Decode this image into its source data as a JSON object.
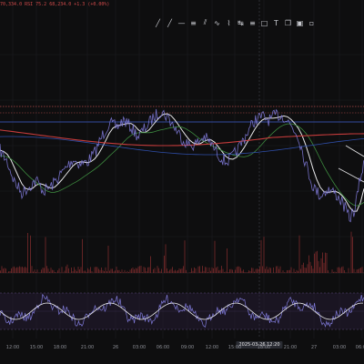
{
  "legend": {
    "items": [
      {
        "text": "70,334.0",
        "color": "#d04a4a"
      },
      {
        "text": "RSI 75.2",
        "color": "#d04a4a"
      },
      {
        "text": "68,234.0  +1.3 (+0.00%)",
        "color": "#d04a4a"
      }
    ]
  },
  "toolbar": {
    "icons": [
      "line-icon",
      "ray-icon",
      "hline-icon",
      "channel-icon",
      "pitchfork-icon",
      "brush-icon",
      "pattern-icon",
      "measure-icon",
      "fib-icon",
      "rect-icon",
      "text-icon",
      "note-icon",
      "gann-icon",
      "lock-icon"
    ],
    "glyphs": [
      "╱",
      "╱",
      "—",
      "≡",
      "⫽",
      "∿",
      "⌇",
      "↹",
      "≡",
      "□",
      "T",
      "❐",
      "▣",
      "▫"
    ]
  },
  "time_axis": {
    "labels": [
      "12:00",
      "15:00",
      "18:00",
      "21:00",
      "26",
      "03:00",
      "06:00",
      "09:00",
      "12:00",
      "15:00",
      "18:00",
      "21:00",
      "27",
      "03:00",
      "06:00"
    ],
    "cursor_label": "2025-03-26  12:20"
  },
  "colors": {
    "background": "#0e0e0f",
    "price_line": "#7f7ad9",
    "ma_fast": "#e8e8ea",
    "ma_mid": "#3d8a3f",
    "ma_slow": "#c43b3b",
    "ma_blue": "#2f4ea8",
    "level_red": "#b34a4a",
    "level_blue": "#3e5ed0",
    "volume": "#7a2a2a",
    "rsi_band": "#2a1f3a"
  }
}
